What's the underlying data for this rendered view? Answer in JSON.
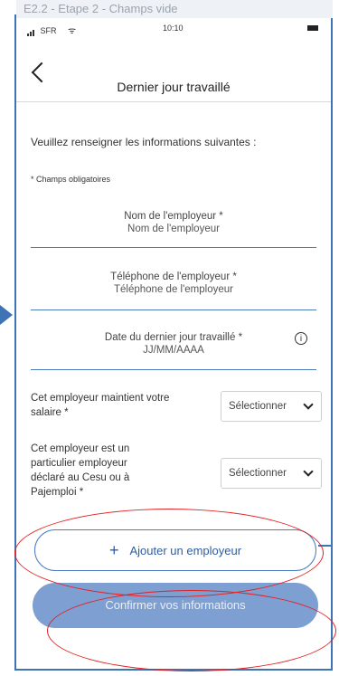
{
  "caption": "E2.2 - Etape 2 - Champs vide",
  "status_bar": {
    "carrier": "SFR",
    "time": "10:10"
  },
  "nav": {
    "title": "Dernier jour travaillé"
  },
  "intro": "Veuillez renseigner les informations suivantes :",
  "required_note": "* Champs obligatoires",
  "fields": [
    {
      "label": "Nom de l'employeur *",
      "placeholder": "Nom de l'employeur"
    },
    {
      "label": "Téléphone de l'employeur *",
      "placeholder": "Téléphone de l'employeur"
    },
    {
      "label": "Date du dernier jour travaillé *",
      "placeholder": "JJ/MM/AAAA"
    }
  ],
  "selects": [
    {
      "label": "Cet employeur maintient votre salaire *",
      "value": "Sélectionner"
    },
    {
      "label": "Cet employeur est un particulier employeur déclaré au Cesu ou à Pajemploi *",
      "value": "Sélectionner"
    }
  ],
  "buttons": {
    "add_employer": "Ajouter un employeur",
    "confirm": "Confirmer vos informations"
  },
  "colors": {
    "accent": "#4b7cc2",
    "confirm_button": "#7e9fd1",
    "annotation": "#e32020"
  },
  "icons": [
    "back-icon",
    "info-icon",
    "chevron-down-icon",
    "plus-icon",
    "signal-icon",
    "wifi-icon",
    "battery-icon"
  ]
}
